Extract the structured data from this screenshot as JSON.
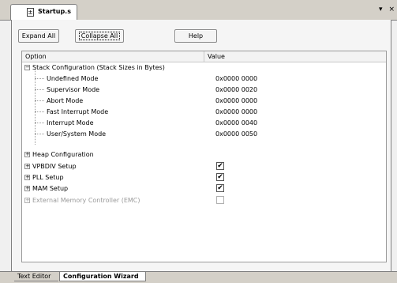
{
  "file_tab": {
    "label": "Startup.s",
    "icon": "asm-file-icon"
  },
  "window_controls": {
    "menu": "▾",
    "close": "×"
  },
  "toolbar": {
    "expand_all": "Expand All",
    "collapse_all": "Collapse All",
    "help": "Help"
  },
  "grid": {
    "header_option": "Option",
    "header_value": "Value",
    "rows": [
      {
        "label": "Stack Configuration (Stack Sizes in Bytes)",
        "expander": "−"
      },
      {
        "label": "Undefined Mode",
        "value": "0x0000 0000"
      },
      {
        "label": "Supervisor Mode",
        "value": "0x0000 0020"
      },
      {
        "label": "Abort Mode",
        "value": "0x0000 0000"
      },
      {
        "label": "Fast Interrupt Mode",
        "value": "0x0000 0000"
      },
      {
        "label": "Interrupt Mode",
        "value": "0x0000 0040"
      },
      {
        "label": "User/System Mode",
        "value": "0x0000 0050"
      },
      {
        "label": "Heap Configuration",
        "expander": "+"
      },
      {
        "label": "VPBDIV Setup",
        "expander": "+",
        "checked": true
      },
      {
        "label": "PLL Setup",
        "expander": "+",
        "checked": true
      },
      {
        "label": "MAM Setup",
        "expander": "+",
        "checked": true
      },
      {
        "label": "External Memory Controller (EMC)",
        "expander": "+",
        "checked": false,
        "disabled": true
      }
    ]
  },
  "bottom_tabs": {
    "text_editor": "Text Editor",
    "config_wizard": "Configuration Wizard"
  },
  "check_mark": "✔"
}
